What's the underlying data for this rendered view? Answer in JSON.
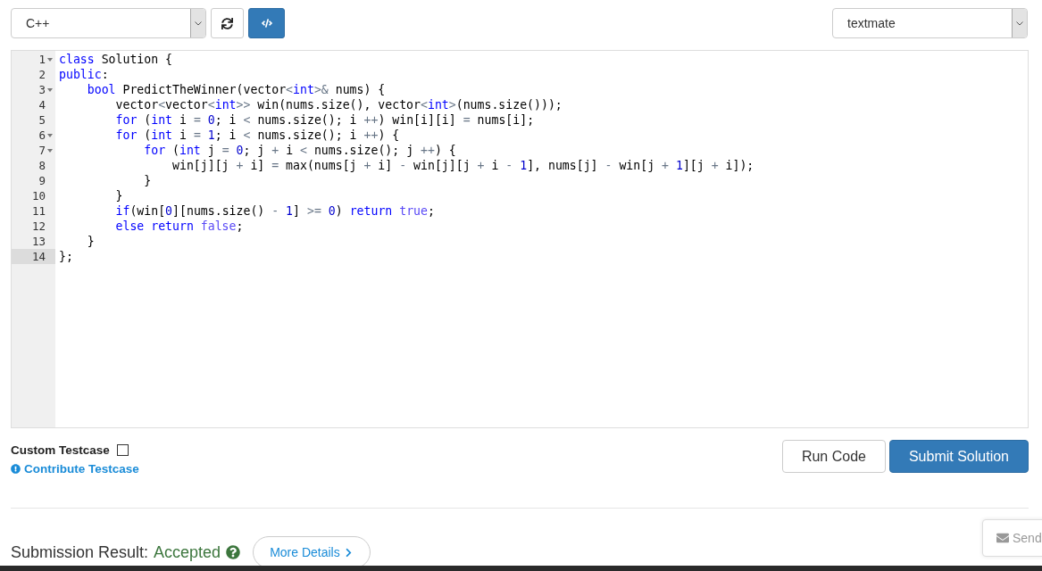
{
  "toolbar": {
    "language": "C++",
    "theme": "textmate"
  },
  "editor": {
    "lines": [
      {
        "number": "1",
        "foldable": true,
        "active": false,
        "tokens": [
          {
            "kind": "keyword",
            "text": "class"
          },
          {
            "kind": "plain",
            "text": " Solution {"
          }
        ]
      },
      {
        "number": "2",
        "foldable": false,
        "active": false,
        "tokens": [
          {
            "kind": "keyword",
            "text": "public"
          },
          {
            "kind": "plain",
            "text": ":"
          }
        ]
      },
      {
        "number": "3",
        "foldable": true,
        "active": false,
        "tokens": [
          {
            "kind": "keyword",
            "text": "    bool"
          },
          {
            "kind": "plain",
            "text": " PredictTheWinner(vector"
          },
          {
            "kind": "operator",
            "text": "<"
          },
          {
            "kind": "keyword",
            "text": "int"
          },
          {
            "kind": "operator",
            "text": ">&"
          },
          {
            "kind": "plain",
            "text": " nums) {"
          }
        ]
      },
      {
        "number": "4",
        "foldable": false,
        "active": false,
        "tokens": [
          {
            "kind": "plain",
            "text": "        vector"
          },
          {
            "kind": "operator",
            "text": "<"
          },
          {
            "kind": "plain",
            "text": "vector"
          },
          {
            "kind": "operator",
            "text": "<"
          },
          {
            "kind": "keyword",
            "text": "int"
          },
          {
            "kind": "operator",
            "text": ">>"
          },
          {
            "kind": "plain",
            "text": " win(nums.size(), vector"
          },
          {
            "kind": "operator",
            "text": "<"
          },
          {
            "kind": "keyword",
            "text": "int"
          },
          {
            "kind": "operator",
            "text": ">"
          },
          {
            "kind": "plain",
            "text": "(nums.size()));"
          }
        ]
      },
      {
        "number": "5",
        "foldable": false,
        "active": false,
        "tokens": [
          {
            "kind": "keyword",
            "text": "        for"
          },
          {
            "kind": "plain",
            "text": " ("
          },
          {
            "kind": "keyword",
            "text": "int"
          },
          {
            "kind": "plain",
            "text": " i "
          },
          {
            "kind": "operator",
            "text": "="
          },
          {
            "kind": "number",
            "text": " 0"
          },
          {
            "kind": "plain",
            "text": "; i "
          },
          {
            "kind": "operator",
            "text": "<"
          },
          {
            "kind": "plain",
            "text": " nums.size(); i "
          },
          {
            "kind": "operator",
            "text": "++"
          },
          {
            "kind": "plain",
            "text": ") win[i][i] "
          },
          {
            "kind": "operator",
            "text": "="
          },
          {
            "kind": "plain",
            "text": " nums[i];"
          }
        ]
      },
      {
        "number": "6",
        "foldable": true,
        "active": false,
        "tokens": [
          {
            "kind": "keyword",
            "text": "        for"
          },
          {
            "kind": "plain",
            "text": " ("
          },
          {
            "kind": "keyword",
            "text": "int"
          },
          {
            "kind": "plain",
            "text": " i "
          },
          {
            "kind": "operator",
            "text": "="
          },
          {
            "kind": "number",
            "text": " 1"
          },
          {
            "kind": "plain",
            "text": "; i "
          },
          {
            "kind": "operator",
            "text": "<"
          },
          {
            "kind": "plain",
            "text": " nums.size(); i "
          },
          {
            "kind": "operator",
            "text": "++"
          },
          {
            "kind": "plain",
            "text": ") {"
          }
        ]
      },
      {
        "number": "7",
        "foldable": true,
        "active": false,
        "tokens": [
          {
            "kind": "keyword",
            "text": "            for"
          },
          {
            "kind": "plain",
            "text": " ("
          },
          {
            "kind": "keyword",
            "text": "int"
          },
          {
            "kind": "plain",
            "text": " j "
          },
          {
            "kind": "operator",
            "text": "="
          },
          {
            "kind": "number",
            "text": " 0"
          },
          {
            "kind": "plain",
            "text": "; j "
          },
          {
            "kind": "operator",
            "text": "+"
          },
          {
            "kind": "plain",
            "text": " i "
          },
          {
            "kind": "operator",
            "text": "<"
          },
          {
            "kind": "plain",
            "text": " nums.size(); j "
          },
          {
            "kind": "operator",
            "text": "++"
          },
          {
            "kind": "plain",
            "text": ") {"
          }
        ]
      },
      {
        "number": "8",
        "foldable": false,
        "active": false,
        "tokens": [
          {
            "kind": "plain",
            "text": "                win[j][j "
          },
          {
            "kind": "operator",
            "text": "+"
          },
          {
            "kind": "plain",
            "text": " i] "
          },
          {
            "kind": "operator",
            "text": "="
          },
          {
            "kind": "plain",
            "text": " max(nums[j "
          },
          {
            "kind": "operator",
            "text": "+"
          },
          {
            "kind": "plain",
            "text": " i] "
          },
          {
            "kind": "operator",
            "text": "-"
          },
          {
            "kind": "plain",
            "text": " win[j][j "
          },
          {
            "kind": "operator",
            "text": "+"
          },
          {
            "kind": "plain",
            "text": " i "
          },
          {
            "kind": "operator",
            "text": "-"
          },
          {
            "kind": "number",
            "text": " 1"
          },
          {
            "kind": "plain",
            "text": "], nums[j] "
          },
          {
            "kind": "operator",
            "text": "-"
          },
          {
            "kind": "plain",
            "text": " win[j "
          },
          {
            "kind": "operator",
            "text": "+"
          },
          {
            "kind": "number",
            "text": " 1"
          },
          {
            "kind": "plain",
            "text": "][j "
          },
          {
            "kind": "operator",
            "text": "+"
          },
          {
            "kind": "plain",
            "text": " i]);"
          }
        ]
      },
      {
        "number": "9",
        "foldable": false,
        "active": false,
        "tokens": [
          {
            "kind": "plain",
            "text": "            }"
          }
        ]
      },
      {
        "number": "10",
        "foldable": false,
        "active": false,
        "tokens": [
          {
            "kind": "plain",
            "text": "        }"
          }
        ]
      },
      {
        "number": "11",
        "foldable": false,
        "active": false,
        "tokens": [
          {
            "kind": "keyword",
            "text": "        if"
          },
          {
            "kind": "plain",
            "text": "(win["
          },
          {
            "kind": "number",
            "text": "0"
          },
          {
            "kind": "plain",
            "text": "][nums.size() "
          },
          {
            "kind": "operator",
            "text": "-"
          },
          {
            "kind": "number",
            "text": " 1"
          },
          {
            "kind": "plain",
            "text": "] "
          },
          {
            "kind": "operator",
            "text": ">="
          },
          {
            "kind": "number",
            "text": " 0"
          },
          {
            "kind": "plain",
            "text": ") "
          },
          {
            "kind": "keyword",
            "text": "return"
          },
          {
            "kind": "constant",
            "text": " true"
          },
          {
            "kind": "plain",
            "text": ";"
          }
        ]
      },
      {
        "number": "12",
        "foldable": false,
        "active": false,
        "tokens": [
          {
            "kind": "keyword",
            "text": "        else"
          },
          {
            "kind": "keyword",
            "text": " return"
          },
          {
            "kind": "constant",
            "text": " false"
          },
          {
            "kind": "plain",
            "text": ";"
          }
        ]
      },
      {
        "number": "13",
        "foldable": false,
        "active": false,
        "tokens": [
          {
            "kind": "plain",
            "text": "    }"
          }
        ]
      },
      {
        "number": "14",
        "foldable": false,
        "active": true,
        "tokens": [
          {
            "kind": "plain",
            "text": "};"
          }
        ]
      }
    ]
  },
  "testcase": {
    "label": "Custom Testcase",
    "checked": false,
    "link": "Contribute Testcase"
  },
  "actions": {
    "run": "Run Code",
    "submit": "Submit Solution"
  },
  "result": {
    "label": "Submission Result:",
    "status": "Accepted",
    "details": "More Details"
  },
  "feedback": {
    "label": "Send"
  }
}
